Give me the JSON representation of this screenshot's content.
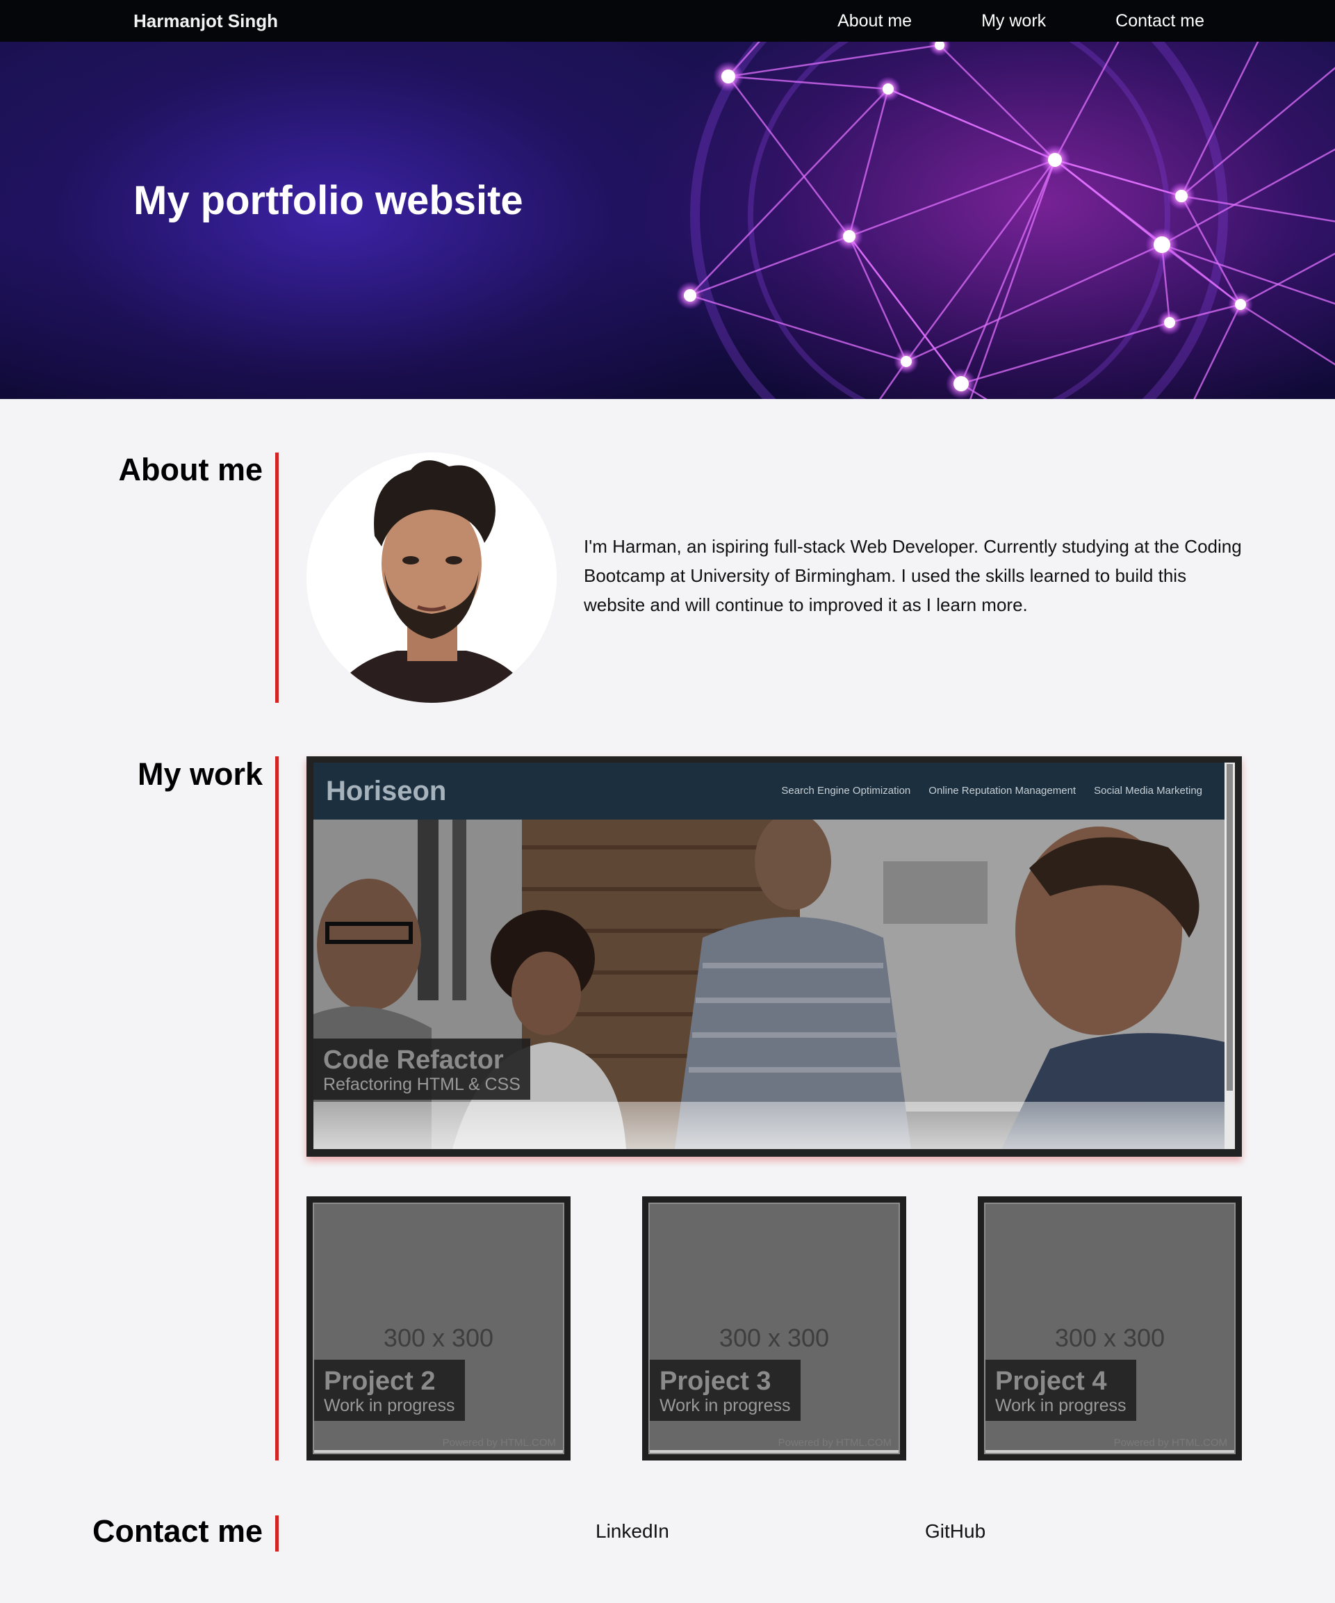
{
  "nav": {
    "brand": "Harmanjot Singh",
    "links": [
      "About me",
      "My work",
      "Contact me"
    ]
  },
  "hero": {
    "title": "My portfolio website"
  },
  "about": {
    "heading": "About me",
    "bio": "I'm Harman, an ispiring full-stack Web Developer. Currently studying at the Coding Bootcamp at University of Birmingham. I used the skills learned to build this website and will continue to improved it as I learn more."
  },
  "work": {
    "heading": "My work",
    "featured": {
      "site_logo": "Horiseon",
      "site_nav": [
        "Search Engine Optimization",
        "Online Reputation Management",
        "Social Media Marketing"
      ],
      "title": "Code Refactor",
      "subtitle": "Refactoring HTML & CSS"
    },
    "projects": [
      {
        "placeholder": "300 x 300",
        "title": "Project 2",
        "subtitle": "Work in progress",
        "powered": "Powered by HTML.COM"
      },
      {
        "placeholder": "300 x 300",
        "title": "Project 3",
        "subtitle": "Work in progress",
        "powered": "Powered by HTML.COM"
      },
      {
        "placeholder": "300 x 300",
        "title": "Project 4",
        "subtitle": "Work in progress",
        "powered": "Powered by HTML.COM"
      }
    ]
  },
  "contact": {
    "heading": "Contact me",
    "links": [
      "LinkedIn",
      "GitHub"
    ]
  },
  "colors": {
    "accent": "#d32323",
    "nav_bg": "#05060a",
    "page_bg": "#f4f4f6"
  }
}
